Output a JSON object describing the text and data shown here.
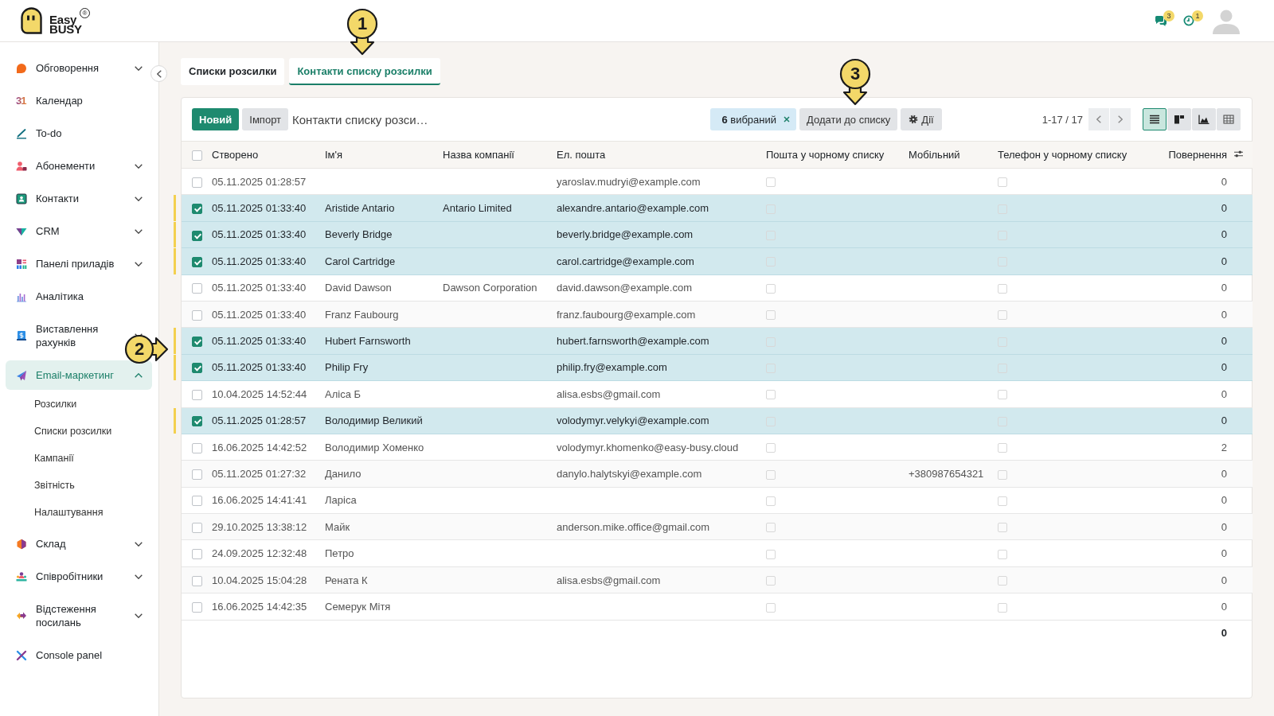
{
  "header": {
    "logo": {
      "top_line": "Easy",
      "bottom_line": "BUSY",
      "mark": "®"
    },
    "notifications": [
      {
        "kind": "messages",
        "count": "3"
      },
      {
        "kind": "activities",
        "count": "1"
      }
    ]
  },
  "sidebar": {
    "items": [
      {
        "label": "Обговорення",
        "selected": false,
        "expanded": false
      },
      {
        "label": "Календар",
        "selected": false,
        "icon_text": "31"
      },
      {
        "label": "To-do",
        "selected": false
      },
      {
        "label": "Абонементи",
        "selected": false,
        "expanded": false
      },
      {
        "label": "Контакти",
        "selected": false,
        "expanded": false
      },
      {
        "label": "CRM",
        "selected": false,
        "expanded": false
      },
      {
        "label": "Панелі приладів",
        "selected": false,
        "expanded": false
      },
      {
        "label": "Аналітика",
        "selected": false
      },
      {
        "label": "Виставлення рахунків",
        "selected": false,
        "expanded": false
      },
      {
        "label": "Email-маркетинг",
        "selected": true,
        "expanded": true,
        "children": [
          {
            "label": "Розсилки",
            "selected": false
          },
          {
            "label": "Списки розсилки",
            "selected": false
          },
          {
            "label": "Кампанії",
            "selected": false
          },
          {
            "label": "Звітність",
            "selected": false
          },
          {
            "label": "Налаштування",
            "selected": false
          }
        ]
      },
      {
        "label": "Склад",
        "selected": false,
        "expanded": false
      },
      {
        "label": "Співробітники",
        "selected": false,
        "expanded": false
      },
      {
        "label": "Відстеження посилань",
        "selected": false,
        "expanded": false
      },
      {
        "label": "Console panel",
        "selected": false
      }
    ]
  },
  "tabs": [
    {
      "label": "Списки розсилки",
      "selected": false
    },
    {
      "label": "Контакти списку розсилки",
      "selected": true
    }
  ],
  "toolbar": {
    "new_button": "Новий",
    "import_button": "Імпорт",
    "title": "Контакти списку розси…",
    "selection": "**6** вибраний",
    "add_to_list_button": "Додати до списку",
    "actions_button": "Дії",
    "pager": "1-17 / 17",
    "views": [
      {
        "kind": "list",
        "selected": true
      },
      {
        "kind": "kanban",
        "selected": false
      },
      {
        "kind": "graph",
        "selected": false
      },
      {
        "kind": "pivot",
        "selected": false
      }
    ]
  },
  "table": {
    "all_selected": false,
    "columns": [
      "Створено",
      "Ім'я",
      "Назва компанії",
      "Ел. пошта",
      "Пошта у чорному списку",
      "Мобільний",
      "Телефон у чорному списку",
      "Повернення"
    ],
    "rows": [
      {
        "selected": false,
        "created": "05.11.2025 01:28:57",
        "email": "yaroslav.mudryi@example.com",
        "email_blacklisted": false,
        "phone_blacklisted": false,
        "bounce": "0"
      },
      {
        "selected": true,
        "created": "05.11.2025 01:33:40",
        "name": "Aristide Antario",
        "company": "Antario Limited",
        "email": "alexandre.antario@example.com",
        "email_blacklisted": false,
        "phone_blacklisted": false,
        "bounce": "0"
      },
      {
        "selected": true,
        "created": "05.11.2025 01:33:40",
        "name": "Beverly Bridge",
        "email": "beverly.bridge@example.com",
        "email_blacklisted": false,
        "phone_blacklisted": false,
        "bounce": "0"
      },
      {
        "selected": true,
        "created": "05.11.2025 01:33:40",
        "name": "Carol Cartridge",
        "email": "carol.cartridge@example.com",
        "email_blacklisted": false,
        "phone_blacklisted": false,
        "bounce": "0"
      },
      {
        "selected": false,
        "created": "05.11.2025 01:33:40",
        "name": "David Dawson",
        "company": "Dawson Corporation",
        "email": "david.dawson@example.com",
        "email_blacklisted": false,
        "phone_blacklisted": false,
        "bounce": "0"
      },
      {
        "selected": false,
        "created": "05.11.2025 01:33:40",
        "name": "Franz Faubourg",
        "email": "franz.faubourg@example.com",
        "email_blacklisted": false,
        "phone_blacklisted": false,
        "bounce": "0"
      },
      {
        "selected": true,
        "created": "05.11.2025 01:33:40",
        "name": "Hubert Farnsworth",
        "email": "hubert.farnsworth@example.com",
        "email_blacklisted": false,
        "phone_blacklisted": false,
        "bounce": "0"
      },
      {
        "selected": true,
        "created": "05.11.2025 01:33:40",
        "name": "Philip Fry",
        "email": "philip.fry@example.com",
        "email_blacklisted": false,
        "phone_blacklisted": false,
        "bounce": "0"
      },
      {
        "selected": false,
        "created": "10.04.2025 14:52:44",
        "name": "Аліса Б",
        "email": "alisa.esbs@gmail.com",
        "email_blacklisted": false,
        "phone_blacklisted": false,
        "bounce": "0"
      },
      {
        "selected": true,
        "created": "05.11.2025 01:28:57",
        "name": "Володимир Великий",
        "email": "volodymyr.velykyi@example.com",
        "email_blacklisted": false,
        "phone_blacklisted": false,
        "bounce": "0"
      },
      {
        "selected": false,
        "created": "16.06.2025 14:42:52",
        "name": "Володимир Хоменко",
        "email": "volodymyr.khomenko@easy-busy.cloud",
        "email_blacklisted": false,
        "phone_blacklisted": false,
        "bounce": "2"
      },
      {
        "selected": false,
        "created": "05.11.2025 01:27:32",
        "name": "Данило",
        "email": "danylo.halytskyi@example.com",
        "email_blacklisted": false,
        "mobile": "+380987654321",
        "phone_blacklisted": false,
        "bounce": "0"
      },
      {
        "selected": false,
        "created": "16.06.2025 14:41:41",
        "name": "Ларіса",
        "email_blacklisted": false,
        "phone_blacklisted": false,
        "bounce": "0"
      },
      {
        "selected": false,
        "created": "29.10.2025 13:38:12",
        "name": "Майк",
        "email": "anderson.mike.office@gmail.com",
        "email_blacklisted": false,
        "phone_blacklisted": false,
        "bounce": "0"
      },
      {
        "selected": false,
        "created": "24.09.2025 12:32:48",
        "name": "Петро",
        "email_blacklisted": false,
        "phone_blacklisted": false,
        "bounce": "0"
      },
      {
        "selected": false,
        "created": "10.04.2025 15:04:28",
        "name": "Рената К",
        "email": "alisa.esbs@gmail.com",
        "email_blacklisted": false,
        "phone_blacklisted": false,
        "bounce": "0"
      },
      {
        "selected": false,
        "created": "16.06.2025 14:42:35",
        "name": "Семерук Мітя",
        "email_blacklisted": false,
        "phone_blacklisted": false,
        "bounce": "0"
      }
    ],
    "total": "0"
  },
  "callouts": [
    {
      "label": "1",
      "kind": "down"
    },
    {
      "label": "2",
      "kind": "right"
    },
    {
      "label": "3",
      "kind": "down"
    }
  ]
}
